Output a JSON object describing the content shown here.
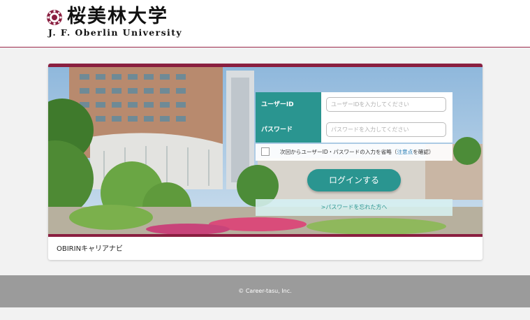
{
  "header": {
    "logo_jp": "桜美林大学",
    "logo_en": "J. F. Oberlin University"
  },
  "login": {
    "user_id_label": "ユーザーID",
    "user_id_placeholder": "ユーザーIDを入力してください",
    "password_label": "パスワード",
    "password_placeholder": "パスワードを入力してください",
    "remember_text_before": "次回からユーザーID・パスワードの入力を省略（",
    "remember_note_link": "注意点",
    "remember_text_after": "を確認）",
    "login_button": "ログインする",
    "forgot_link": ">パスワードを忘れた方へ"
  },
  "card": {
    "service_name": "OBIRINキャリアナビ"
  },
  "footer": {
    "copyright": "© Career-tasu, Inc."
  },
  "colors": {
    "brand_maroon": "#8a1f40",
    "teal": "#2a9590",
    "footer_gray": "#9b9b9b"
  }
}
